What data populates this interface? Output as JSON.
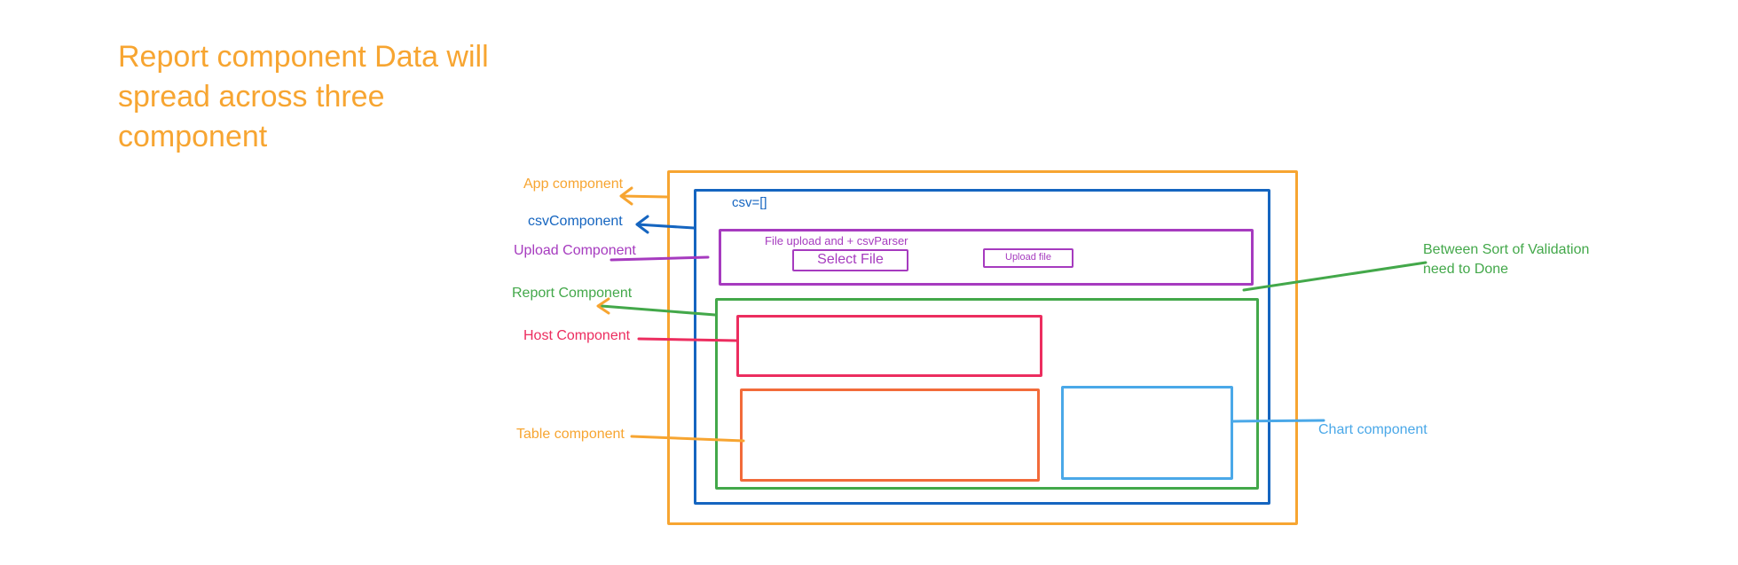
{
  "heading": {
    "lines": [
      "Report component Data will",
      "spread across three",
      "component"
    ]
  },
  "labels": {
    "app": "App component",
    "csv": "csvComponent",
    "upload": "Upload Component",
    "report": "Report Component",
    "host": "Host Component",
    "table": "Table component",
    "chart": "Chart component",
    "validation_line1": "Between Sort of Validation",
    "validation_line2": "need to Done"
  },
  "inner": {
    "csv_state": "csv=[]",
    "upload_caption": "File upload and + csvParser",
    "select_file_button": "Select File",
    "upload_file_button": "Upload file"
  },
  "colors": {
    "app": "#F7A531",
    "csv": "#1565C0",
    "upload": "#A63BBF",
    "report": "#43A84A",
    "host": "#EC2D5F",
    "table": "#F26B3A",
    "chart": "#4AA8E8"
  }
}
